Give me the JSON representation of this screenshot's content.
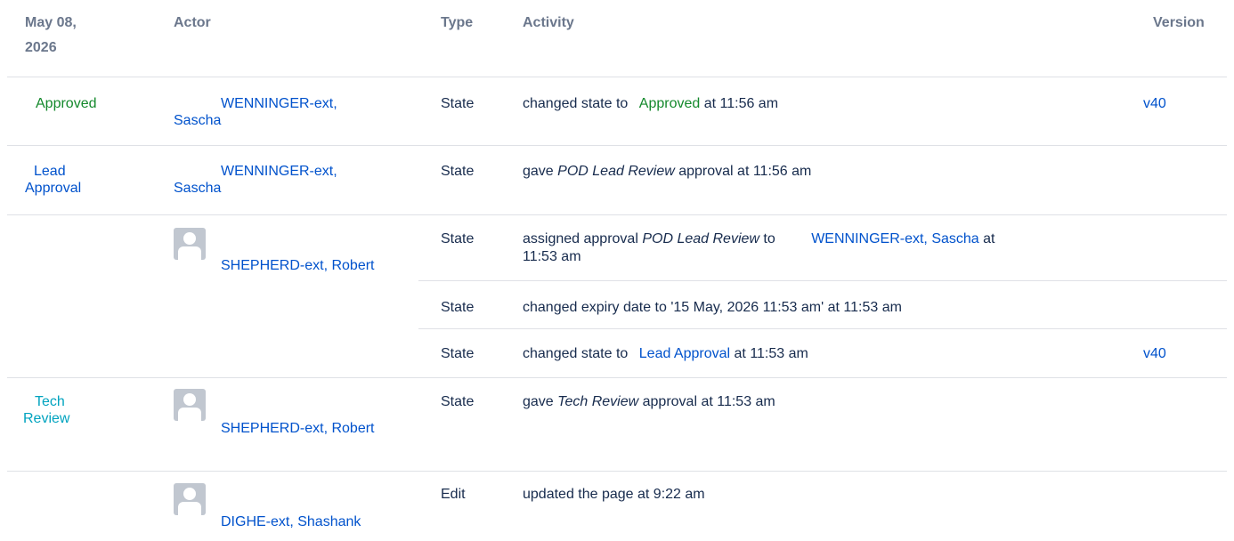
{
  "header": {
    "date_line1": "May 08,",
    "date_line2": "2026",
    "actor": "Actor",
    "type": "Type",
    "activity": "Activity",
    "version": "Version"
  },
  "rows": [
    {
      "state": "Approved",
      "actor": "WENNINGER-ext, Sascha",
      "events": [
        {
          "type": "State",
          "prefix": "changed state to",
          "link": "Approved",
          "suffix": "at 11:56 am",
          "version": "v40"
        }
      ]
    },
    {
      "state": "Lead Approval",
      "actor": "WENNINGER-ext, Sascha",
      "events": [
        {
          "type": "State",
          "prefix": "gave",
          "italic": "POD Lead Review",
          "suffix": "approval at 11:56 am"
        }
      ]
    },
    {
      "state": "",
      "actor": "SHEPHERD-ext, Robert",
      "events": [
        {
          "type": "State",
          "prefix": "assigned approval",
          "italic": "POD Lead Review",
          "mid": "to",
          "link": "WENNINGER-ext, Sascha",
          "suffix": "at",
          "line2": "11:53 am"
        },
        {
          "type": "State",
          "text": "changed expiry date to '15 May, 2026 11:53 am' at 11:53 am"
        },
        {
          "type": "State",
          "prefix": "changed state to",
          "link": "Lead Approval",
          "suffix": "at 11:53 am",
          "version": "v40"
        }
      ]
    },
    {
      "state": "Tech Review",
      "actor": "SHEPHERD-ext, Robert",
      "events": [
        {
          "type": "State",
          "prefix": "gave",
          "italic": "Tech Review",
          "suffix": "approval at 11:53 am"
        }
      ]
    },
    {
      "state": "",
      "actor": "DIGHE-ext, Shashank",
      "events": [
        {
          "type": "Edit",
          "text": "updated the page at 9:22 am"
        }
      ]
    }
  ],
  "colors": {
    "link": "#0052cc",
    "approved_green": "#14892c",
    "tech_review_teal": "#00a3bf",
    "header_gray": "#6b778c",
    "divider": "#dfe1e6"
  }
}
